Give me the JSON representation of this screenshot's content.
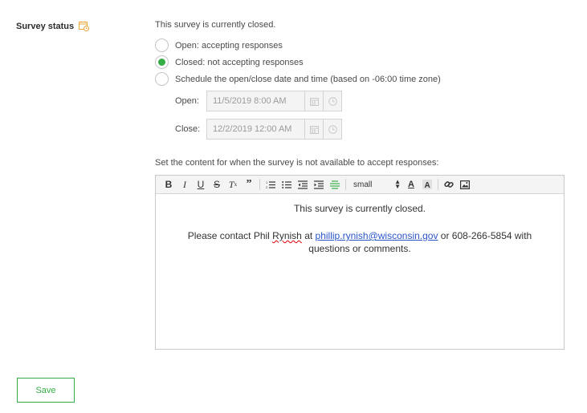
{
  "section": {
    "label": "Survey status",
    "icon": "calendar-clock-icon"
  },
  "status": {
    "text": "This survey is currently closed."
  },
  "options": [
    {
      "label": "Open: accepting responses",
      "selected": false
    },
    {
      "label": "Closed: not accepting responses",
      "selected": true
    },
    {
      "label": "Schedule the open/close date and time (based on -06:00 time zone)",
      "selected": false
    }
  ],
  "schedule": {
    "open_label": "Open:",
    "open_value": "11/5/2019 8:00 AM",
    "close_label": "Close:",
    "close_value": "12/2/2019 12:00 AM"
  },
  "content_label": "Set the content for when the survey is not available to accept responses:",
  "editor": {
    "font_size": "small",
    "line1": "This survey is currently closed.",
    "line2_pre": "Please contact Phil ",
    "line2_name": "Rynish",
    "line2_at": " at ",
    "line2_email": "phillip.rynish@wisconsin.gov",
    "line2_post": " or 608-266-5854 with questions or comments."
  },
  "save_label": "Save",
  "colors": {
    "accent": "#35ac46",
    "link": "#2a55c8",
    "icon_orange": "#e8a53a"
  }
}
